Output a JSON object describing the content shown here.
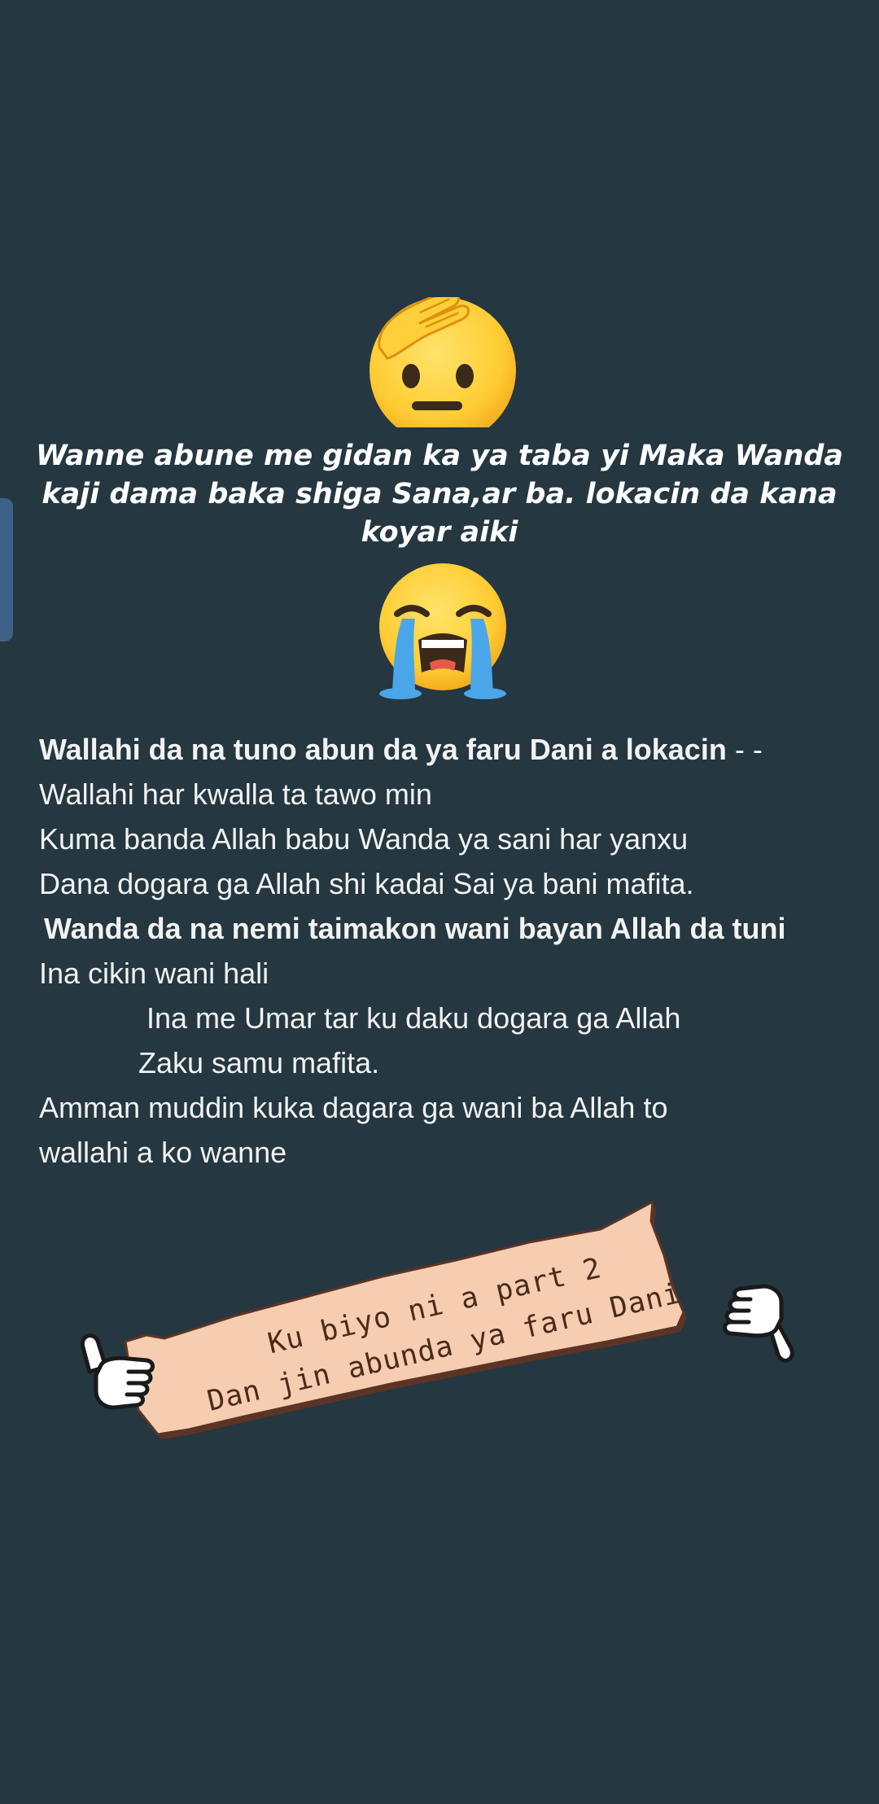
{
  "intro": {
    "lines": [
      "Wanne abune me gidan ka ya taba yi Maka Wanda",
      "kaji dama baka shiga Sana,ar ba. lokacin da kana",
      "koyar aiki"
    ]
  },
  "body": {
    "line1_bold": "Wallahi da na tuno abun da ya faru Dani a lokacin",
    "line1_suffix": " - -",
    "line2": "Wallahi har kwalla ta tawo min",
    "line3": "Kuma banda Allah babu Wanda ya sani har yanxu",
    "line4": "Dana dogara ga Allah shi kadai Sai ya bani mafita.",
    "line5_bold": "Wanda da na nemi taimakon wani bayan Allah da tuni",
    "line6": "Ina cikin wani hali",
    "line7": "Ina me Umar tar ku daku dogara ga Allah",
    "line8": "Zaku samu mafita.",
    "line9": "Amman muddin kuka dagara ga wani ba Allah to",
    "line10": "wallahi a ko wanne"
  },
  "banner": {
    "line1": "Ku biyo ni a part 2",
    "line2": "Dan jin abunda ya faru Dani"
  },
  "icons": {
    "top_emoji": "saluting-face-icon",
    "middle_emoji": "loudly-crying-face-icon",
    "left_hand": "thumbs-up-icon",
    "right_hand": "thumbs-down-icon"
  },
  "colors": {
    "background": "#253740",
    "banner_paper": "#f6cdb0",
    "banner_text": "#4a2b1b",
    "emoji_yellow": "#ffcc33",
    "edge_tab": "#3d6286"
  }
}
